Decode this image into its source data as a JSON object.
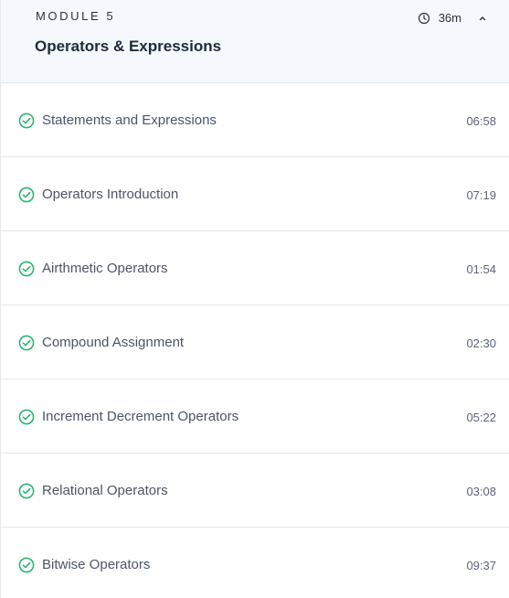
{
  "module": {
    "label": "MODULE 5",
    "title": "Operators & Expressions",
    "duration": "36m",
    "duration_icon": "clock-icon",
    "collapse_icon": "chevron-up-icon"
  },
  "lessons": [
    {
      "title": "Statements and Expressions",
      "time": "06:58",
      "status": "completed",
      "icon": "check-circle-icon"
    },
    {
      "title": "Operators Introduction",
      "time": "07:19",
      "status": "completed",
      "icon": "check-circle-icon"
    },
    {
      "title": "Airthmetic Operators",
      "time": "01:54",
      "status": "completed",
      "icon": "check-circle-icon"
    },
    {
      "title": "Compound Assignment",
      "time": "02:30",
      "status": "completed",
      "icon": "check-circle-icon"
    },
    {
      "title": "Increment Decrement Operators",
      "time": "05:22",
      "status": "completed",
      "icon": "check-circle-icon"
    },
    {
      "title": "Relational Operators",
      "time": "03:08",
      "status": "completed",
      "icon": "check-circle-icon"
    },
    {
      "title": "Bitwise Operators",
      "time": "09:37",
      "status": "completed",
      "icon": "check-circle-icon"
    }
  ],
  "colors": {
    "completed_check": "#2bb673",
    "header_bg": "#f5f8fc",
    "divider": "#e4e7ec",
    "title_text": "#1f2a3d",
    "body_text": "#4b5566"
  }
}
